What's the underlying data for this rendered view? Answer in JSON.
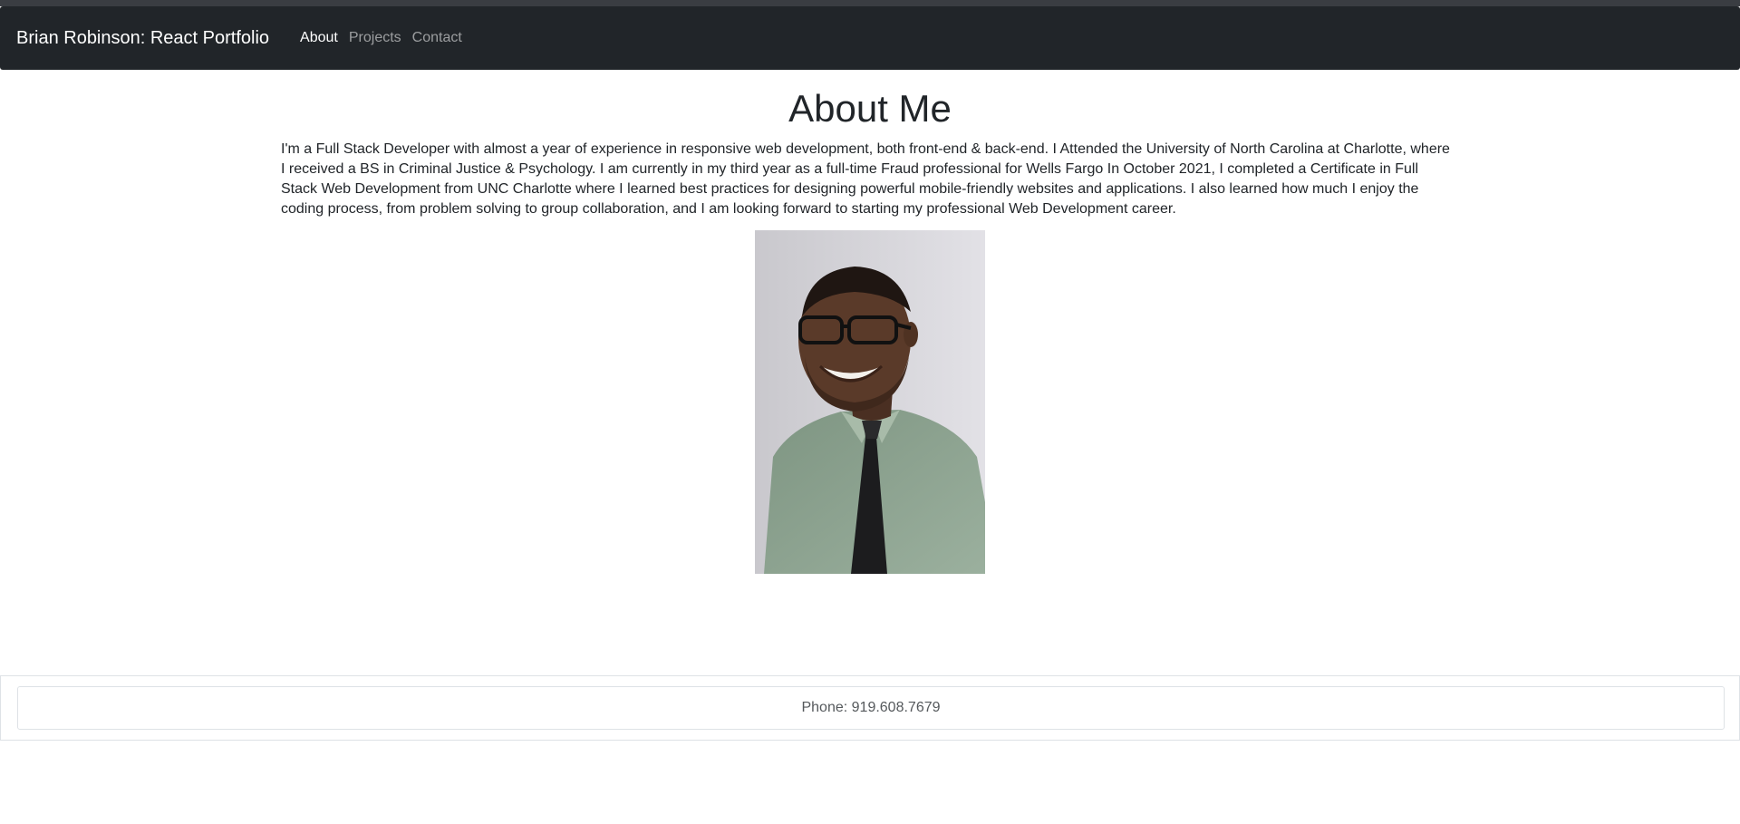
{
  "navbar": {
    "brand": "Brian Robinson: React Portfolio",
    "links": [
      {
        "label": "About",
        "active": true
      },
      {
        "label": "Projects",
        "active": false
      },
      {
        "label": "Contact",
        "active": false
      }
    ]
  },
  "about": {
    "title": "About Me",
    "paragraph": "I'm a Full Stack Developer with almost a year of experience in responsive web development, both front-end & back-end. I Attended the University of North Carolina at Charlotte, where I received a BS in Criminal Justice & Psychology. I am currently in my third year as a full-time Fraud professional for Wells Fargo In October 2021, I completed a Certificate in Full Stack Web Development from UNC Charlotte where I learned best practices for designing powerful mobile-friendly websites and applications. I also learned how much I enjoy the coding process, from problem solving to group collaboration, and I am looking forward to starting my professional Web Development career."
  },
  "footer": {
    "phone": "Phone: 919.608.7679"
  },
  "colors": {
    "navbar_bg": "#212529",
    "link_active": "#ffffff",
    "link_inactive": "#9a9da0",
    "text": "#212529",
    "border": "#dee2e6"
  }
}
